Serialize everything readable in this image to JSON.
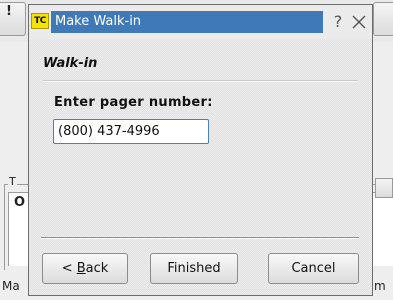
{
  "background": {
    "top_left_button": "!",
    "group_title": "T",
    "group_first_char": "O",
    "bottom_left_text": "Ma",
    "bottom_right_text": "m"
  },
  "dialog": {
    "title_logo": "TC",
    "title": "Make Walk-in",
    "help_label": "?",
    "heading": "Walk-in",
    "field_label": "Enter pager number:",
    "pager_value": "(800) 437-4996",
    "buttons": {
      "back_prefix": "< ",
      "back_mnemonic": "B",
      "back_rest": "ack",
      "finished": "Finished",
      "cancel": "Cancel"
    }
  },
  "colors": {
    "title_highlight": "#3f7ab6",
    "logo_yellow": "#f6e100",
    "input_border": "#4a7fb8"
  },
  "icons": {
    "close": "close-icon",
    "help": "help-icon",
    "app_logo": "app-logo-icon"
  }
}
